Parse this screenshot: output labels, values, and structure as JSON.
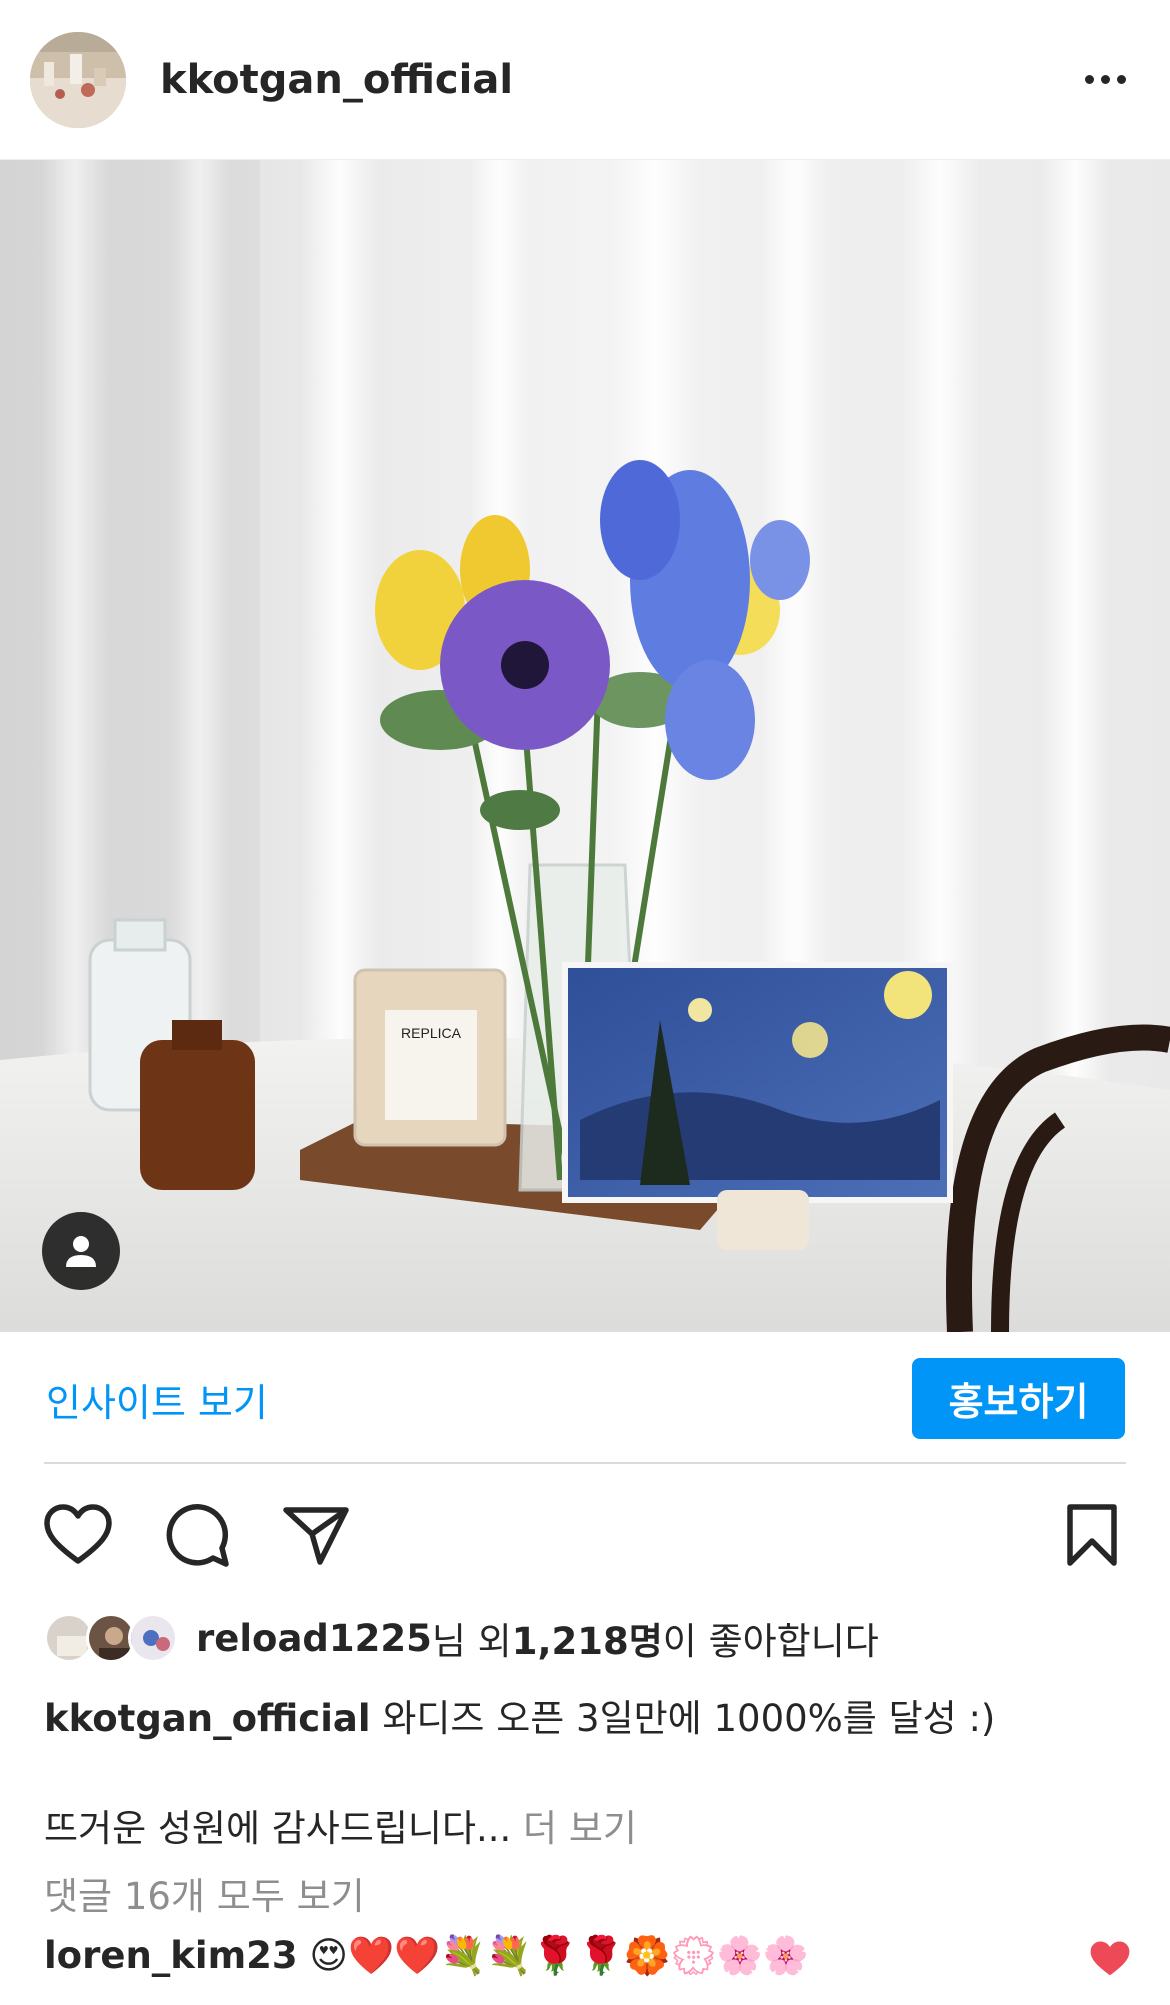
{
  "header": {
    "username": "kkotgan_official",
    "avatar_icon": "profile-photo",
    "more_icon": "more-horizontal-icon"
  },
  "post": {
    "image_description_icon": "flower-bouquet-photo",
    "tag_icon": "user-tag-icon"
  },
  "insight": {
    "view_insights_label": "인사이트 보기",
    "promote_label": "홍보하기"
  },
  "actions": {
    "like_icon": "heart-icon",
    "comment_icon": "comment-icon",
    "share_icon": "send-icon",
    "save_icon": "bookmark-icon"
  },
  "likes": {
    "first_user": "reload1225",
    "honorific": "님 외 ",
    "count": "1,218명",
    "suffix": "이 좋아합니다"
  },
  "caption": {
    "username": "kkotgan_official",
    "text_line1": " 와디즈 오픈 3일만에 1000%를 달성 :)",
    "text_line2": "뜨거운 성원에 감사드립니다...",
    "more_label": " 더 보기"
  },
  "comments": {
    "view_all_label": "댓글 16개 모두 보기",
    "first": {
      "username": "loren_kim23",
      "text": " 😍❤️❤️💐💐🌹🌹🏵️💮🌸🌸"
    }
  },
  "colors": {
    "accent": "#0095f6",
    "like_red": "#ed4956",
    "text": "#262626",
    "muted": "#8e8e8e"
  }
}
